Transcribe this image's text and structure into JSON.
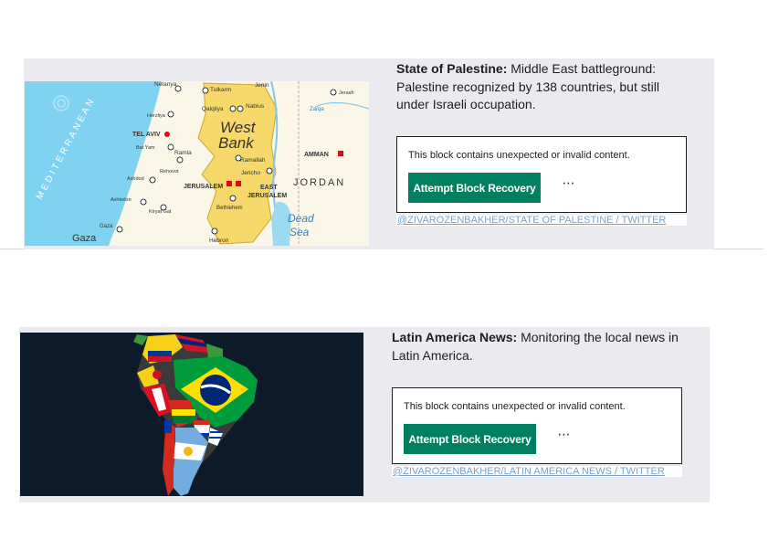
{
  "posts": [
    {
      "title": "State of Palestine:",
      "description": " Middle East battleground: Palestine recognized by 138 countries, but still under Israeli occupation.",
      "invalid_message": "This block contains unexpected or invalid content.",
      "recover_label": "Attempt Block Recovery",
      "more_label": "⋯",
      "credit": "@ZIVAROZENBAKHER/STATE OF PALESTINE / TWITTER",
      "map_labels": {
        "netanya": "Netanya",
        "tulkarm": "Tulkarm",
        "jenin": "Jenin",
        "qalqilya": "Qalqilya",
        "nablus": "Nablus",
        "jerash": "Jerash",
        "zarqa": "Zarqa",
        "herzliya": "Herzliya",
        "tel_aviv": "TEL AVIV",
        "bat_yam": "Bat Yam",
        "west": "West",
        "bank": "Bank",
        "ramla": "Ramla",
        "ramallah": "Ramallah",
        "rehovot": "Rehovot",
        "jericho": "Jericho",
        "amman": "AMMAN",
        "jordan": "JORDAN",
        "ashdod": "Ashdod",
        "jerusalem": "JERUSALEM",
        "east": "EAST",
        "east_jerusalem": "JERUSALEM",
        "ashkelon": "Ashkelon",
        "kiryat_gat": "Kiryat Gat",
        "bethlehem": "Bethlehem",
        "dead": "Dead",
        "sea": "Sea",
        "gaza_city": "Gaza",
        "gaza": "Gaza",
        "hebron": "Hebron",
        "mediterranean": "MEDITERRANEAN"
      }
    },
    {
      "title": "Latin America News:",
      "description": " Monitoring the local news in Latin America.",
      "invalid_message": "This block contains unexpected or invalid content.",
      "recover_label": "Attempt Block Recovery",
      "more_label": "⋯",
      "credit": "@ZIVAROZENBAKHER/LATIN AMERICA NEWS / TWITTER"
    }
  ],
  "colors": {
    "card_bg": "#ebebef",
    "button_green": "#008060",
    "link": "#7aa3c8",
    "sea": "#7fd3f0",
    "west_bank": "#f6d96a",
    "map_land": "#fbf7e8",
    "flag_bg": "#0c1a2a"
  }
}
